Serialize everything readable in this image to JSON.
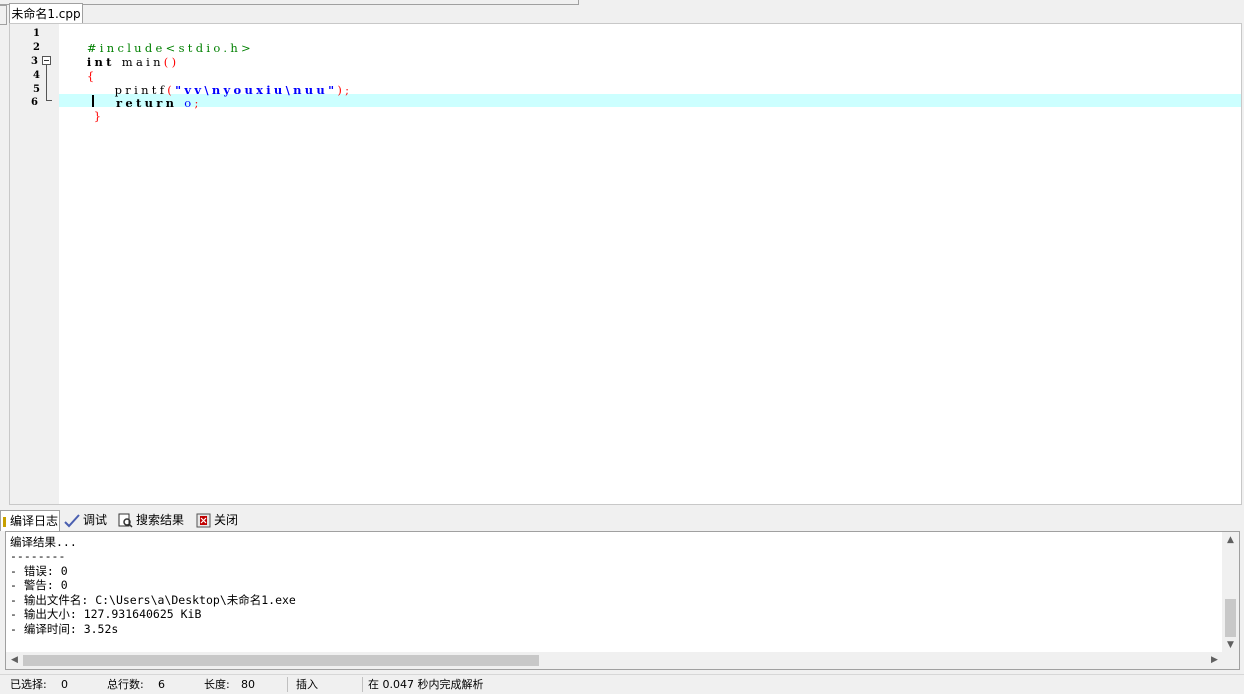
{
  "file_tab": {
    "label": "未命名1.cpp"
  },
  "editor": {
    "line_numbers": [
      "1",
      "2",
      "3",
      "4",
      "5",
      "6"
    ],
    "lines": {
      "l1": {
        "text": "#include<stdio.h>"
      },
      "l2": {
        "kw": "int",
        "rest": " main",
        "paren": "()"
      },
      "l3": {
        "brace": "{"
      },
      "l4": {
        "fn": "    printf",
        "open": "(",
        "str": "\"vv\\nyouxiu\\nuu\"",
        "close": ");"
      },
      "l5": {
        "kw": "    return",
        "sp": " ",
        "num": "o",
        "semi": ";"
      },
      "l6": {
        "brace": " }"
      }
    }
  },
  "bottom_tabs": {
    "compile_log": "编译日志",
    "debug": "调试",
    "search_results": "搜索结果",
    "close": "关闭"
  },
  "log": {
    "lines": [
      "编译结果...",
      "--------",
      "- 错误: 0",
      "- 警告: 0",
      "- 输出文件名: C:\\Users\\a\\Desktop\\未命名1.exe",
      "- 输出大小: 127.931640625 KiB",
      "- 编译时间: 3.52s"
    ]
  },
  "status_bar": {
    "selected_label": "已选择:",
    "selected_value": "0",
    "total_lines_label": "总行数:",
    "total_lines_value": "6",
    "length_label": "长度:",
    "length_value": "80",
    "mode": "插入",
    "parse_message": "在 0.047 秒内完成解析"
  },
  "colors": {
    "highlight_line": "#ccffff",
    "preprocessor": "#008000",
    "brace": "#ff0000",
    "string": "#0000ff"
  }
}
